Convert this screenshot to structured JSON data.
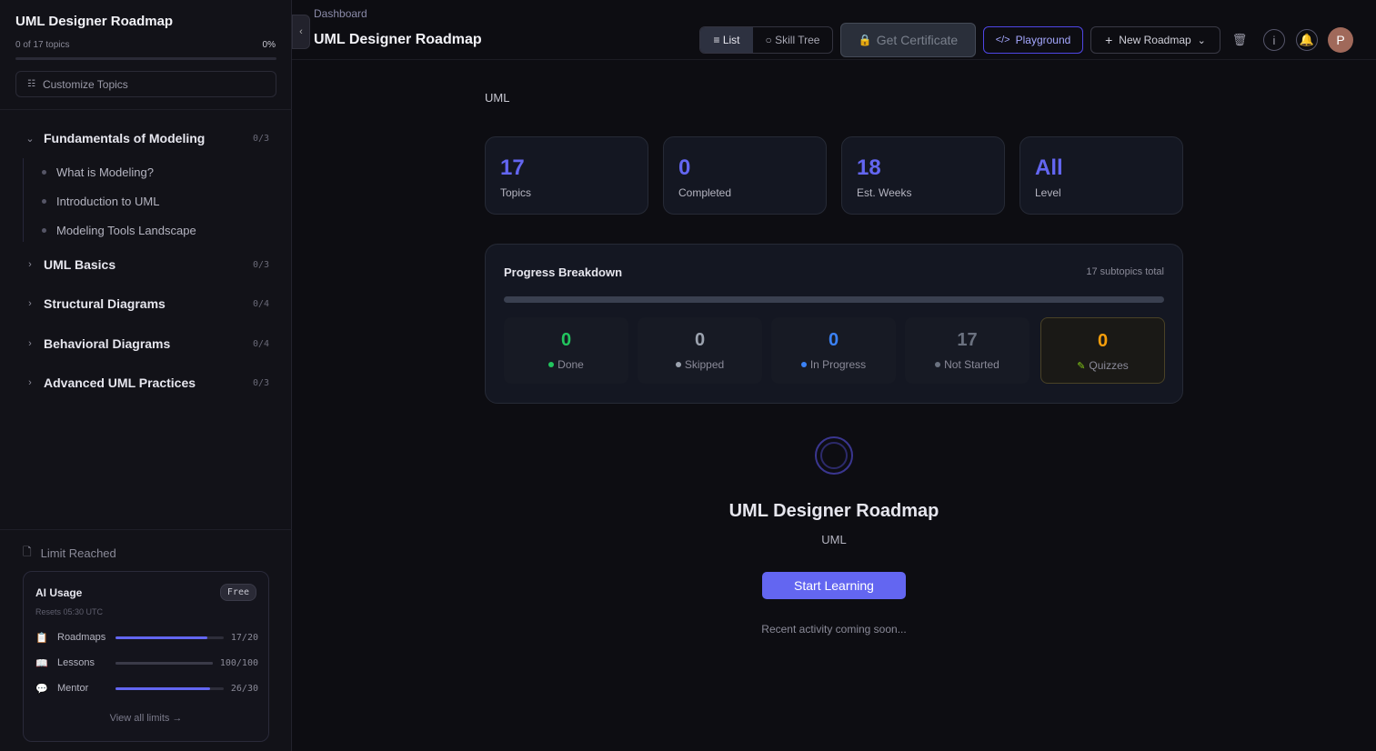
{
  "sidebar": {
    "title": "UML Designer Roadmap",
    "topic_count": "0 of 17 topics",
    "percent": "0%",
    "progress": 0,
    "customize_label": "Customize Topics",
    "sections": [
      {
        "label": "Fundamentals of Modeling",
        "count": "0/3",
        "expanded": true,
        "items": [
          "What is Modeling?",
          "Introduction to UML",
          "Modeling Tools Landscape"
        ]
      },
      {
        "label": "UML Basics",
        "count": "0/3",
        "expanded": false
      },
      {
        "label": "Structural Diagrams",
        "count": "0/4",
        "expanded": false
      },
      {
        "label": "Behavioral Diagrams",
        "count": "0/4",
        "expanded": false
      },
      {
        "label": "Advanced UML Practices",
        "count": "0/3",
        "expanded": false
      }
    ],
    "limit_label": "Limit Reached",
    "usage": {
      "title": "AI Usage",
      "plan": "Free",
      "resets": "Resets 05:30 UTC",
      "rows": [
        {
          "icon": "clipboard-icon",
          "label": "Roadmaps",
          "value": "17/20",
          "fraction": 0.85
        },
        {
          "icon": "book-icon",
          "label": "Lessons",
          "value": "100/100",
          "fraction": 1.0
        },
        {
          "icon": "speech-bubble-icon",
          "label": "Mentor",
          "value": "26/30",
          "fraction": 0.87
        }
      ],
      "view_all": "View all limits →"
    }
  },
  "header": {
    "breadcrumb": "Dashboard",
    "title": "UML Designer Roadmap",
    "view_list": "≡ List",
    "view_tree": "○ Skill Tree",
    "certificate": "Get Certificate",
    "playground": "Playground",
    "new_roadmap": "New Roadmap",
    "avatar_initial": "P"
  },
  "main": {
    "category": "UML",
    "stats": [
      {
        "value": "17",
        "label": "Topics"
      },
      {
        "value": "0",
        "label": "Completed"
      },
      {
        "value": "18",
        "label": "Est. Weeks"
      },
      {
        "value": "All",
        "label": "Level"
      }
    ],
    "breakdown": {
      "title": "Progress Breakdown",
      "total": "17 subtopics total",
      "cells": [
        {
          "value": "0",
          "label": "Done",
          "color": "#22c55e"
        },
        {
          "value": "0",
          "label": "Skipped",
          "color": "#9ca3af"
        },
        {
          "value": "0",
          "label": "In Progress",
          "color": "#3b82f6"
        },
        {
          "value": "17",
          "label": "Not Started",
          "color": "#6b7280"
        },
        {
          "value": "0",
          "label": "Quizzes",
          "color": "#f59e0b"
        }
      ]
    },
    "center_title": "UML Designer Roadmap",
    "center_sub": "UML",
    "start_button": "Start Learning",
    "recent_activity": "Recent activity coming soon..."
  },
  "colors": {
    "accent": "#6366f1",
    "background": "#0d0d12"
  }
}
